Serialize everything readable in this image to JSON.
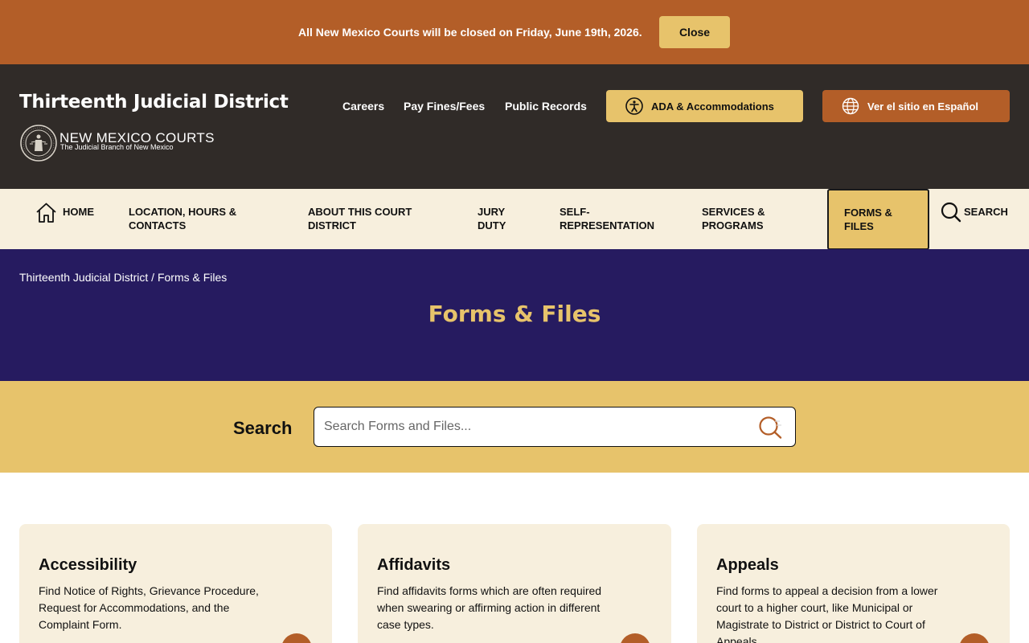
{
  "alert": {
    "message": "All New Mexico Courts will be closed on Friday, June 19th, 2026.",
    "close_label": "Close"
  },
  "header": {
    "site_title": "Thirteenth Judicial District",
    "logo_title": "NEW MEXICO COURTS",
    "logo_subtitle": "The Judicial Branch of New Mexico",
    "util_links": [
      "Careers",
      "Pay Fines/Fees",
      "Public Records"
    ],
    "ada_label": "ADA & Accommodations",
    "espanol_label": "Ver el sitio en Español"
  },
  "nav": {
    "home": "HOME",
    "location_line1": "LOCATION, HOURS &",
    "location_line2": "CONTACTS",
    "about_line1": "ABOUT THIS COURT",
    "about_line2": "DISTRICT",
    "jury_line1": "JURY",
    "jury_line2": "DUTY",
    "self_line1": "SELF-",
    "self_line2": "REPRESENTATION",
    "services_line1": "SERVICES &",
    "services_line2": "PROGRAMS",
    "forms_line1": "FORMS &",
    "forms_line2": "FILES",
    "search": "SEARCH"
  },
  "hero": {
    "breadcrumb": "Thirteenth Judicial District / Forms & Files",
    "title": "Forms & Files"
  },
  "search": {
    "label": "Search",
    "placeholder": "Search Forms and Files...",
    "value": ""
  },
  "cards": [
    {
      "title": "Accessibility",
      "description": "Find Notice of Rights, Grievance Procedure, Request for Accommodations, and the Complaint Form."
    },
    {
      "title": "Affidavits",
      "description": "Find affidavits forms which are often required when swearing or affirming action in different case types."
    },
    {
      "title": "Appeals",
      "description": "Find forms to appeal a decision from a lower court to a higher court, like Municipal or Magistrate to District or District to Court of Appeals."
    }
  ],
  "colors": {
    "rust": "#b35e28",
    "gold": "#e7c36b",
    "dark_header": "#302b28",
    "navy": "#261b60",
    "cream": "#f7efdd"
  }
}
